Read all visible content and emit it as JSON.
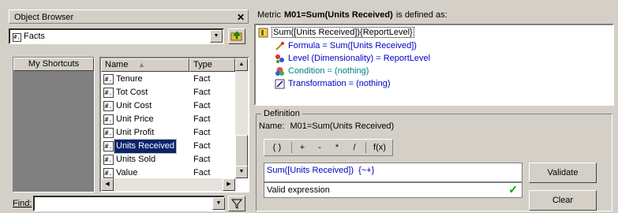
{
  "object_browser": {
    "title": "Object Browser",
    "close_glyph": "✕",
    "folder_value": "Facts",
    "folder_icon_text": "#.",
    "shortcuts_header": "My Shortcuts",
    "columns": [
      "Name",
      "Type"
    ],
    "rows": [
      {
        "name": "Tenure",
        "type": "Fact"
      },
      {
        "name": "Tot Cost",
        "type": "Fact"
      },
      {
        "name": "Unit Cost",
        "type": "Fact"
      },
      {
        "name": "Unit Price",
        "type": "Fact"
      },
      {
        "name": "Unit Profit",
        "type": "Fact"
      },
      {
        "name": "Units Received",
        "type": "Fact",
        "selected": true
      },
      {
        "name": "Units Sold",
        "type": "Fact"
      },
      {
        "name": "Value",
        "type": "Fact"
      }
    ],
    "find_label": "Find:",
    "find_value": ""
  },
  "metric": {
    "prefix": "Metric",
    "name": "M01=Sum(Units Received)",
    "suffix": "is defined as:",
    "tree_root": "Sum([Units Received]){ReportLevel}",
    "tree_items": [
      {
        "text": "Formula = Sum([Units Received])",
        "icon": "formula-icon"
      },
      {
        "text": "Level (Dimensionality) = ReportLevel",
        "icon": "level-icon"
      },
      {
        "text": "Condition = (nothing)",
        "icon": "condition-icon"
      },
      {
        "text": "Transformation = (nothing)",
        "icon": "transformation-icon"
      }
    ]
  },
  "definition": {
    "legend": "Definition",
    "name_label": "Name:",
    "name_value": "M01=Sum(Units Received)",
    "operators": [
      "( )",
      "+",
      "-",
      "*",
      "/",
      "f(x)"
    ],
    "expression_main": "Sum([Units Received])",
    "expression_tail": "{~+}",
    "status": "Valid expression",
    "validate_label": "Validate",
    "clear_label": "Clear"
  },
  "colors": {
    "accent": "#0a246a",
    "face": "#d4d0c8",
    "link": "#0000c8"
  }
}
